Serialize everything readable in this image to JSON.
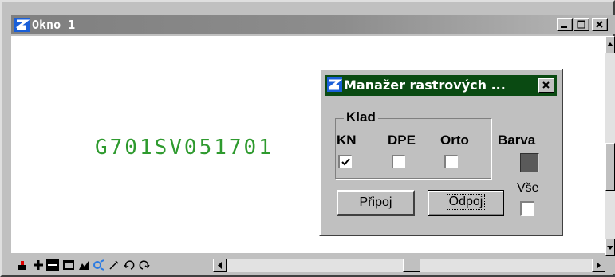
{
  "window": {
    "title": "Okno 1",
    "sheet_label": "G701SV051701"
  },
  "dialog": {
    "title": "Manažer rastrových ...",
    "group_title": "Klad",
    "columns": [
      {
        "label": "KN",
        "checked": true
      },
      {
        "label": "DPE",
        "checked": false
      },
      {
        "label": "Orto",
        "checked": false
      }
    ],
    "color_label": "Barva",
    "color_value": "#5a5a5a",
    "all_label": "Vše",
    "all_checked": false,
    "attach_button": "Připoj",
    "detach_button": "Odpoj"
  },
  "colors": {
    "sheet_label": "#2e9a2e",
    "dialog_titlebar": "#0a4a12",
    "window_titlebar": "#7f7f7f"
  },
  "toolbar_icons": [
    "element-selection-icon",
    "place-point-icon",
    "line-icon",
    "rectangle-icon",
    "fill-icon",
    "fence-icon",
    "pencil-icon",
    "undo-icon",
    "redo-icon"
  ]
}
